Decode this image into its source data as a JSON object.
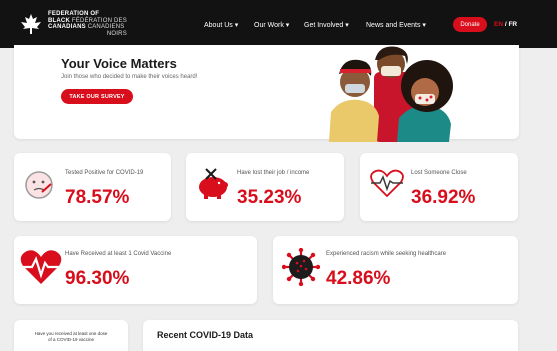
{
  "nav": {
    "logo": {
      "line1": "FEDERATION OF",
      "line2_bold": "BLACK",
      "line2_light": "FÉDÉRATION DES",
      "line3_bold": "CANADIANS",
      "line3_light": "CANADIENS",
      "line4": "NOIRS"
    },
    "items": [
      "About Us ▾",
      "Our Work ▾",
      "Get Involved ▾",
      "News and Events ▾"
    ],
    "donate_label": "Donate",
    "lang_en": "EN",
    "lang_sep": " / ",
    "lang_fr": "FR"
  },
  "hero": {
    "title": "Your Voice Matters",
    "subtitle": "Join those who decided to make their voices heard!",
    "button_label": "TAKE OUR SURVEY"
  },
  "stats": [
    {
      "label": "Tested Positive for COVID-19",
      "value": "78.57%",
      "icon": "sick-face-icon"
    },
    {
      "label": "Have lost their job / income",
      "value": "35.23%",
      "icon": "broken-piggy-bank-icon"
    },
    {
      "label": "Lost Someone Close",
      "value": "36.92%",
      "icon": "heartbeat-icon"
    },
    {
      "label": "Have Received at least 1 Covid Vaccine",
      "value": "96.30%",
      "icon": "heart-pulse-icon"
    },
    {
      "label": "Experienced racism while seeking healthcare",
      "value": "42.86%",
      "icon": "virus-icon"
    }
  ],
  "bottom": {
    "question_line1": "Have you received at least one dose",
    "question_line2": "of a COVID-19 vaccine",
    "recent_title": "Recent COVID-19 Data"
  },
  "colors": {
    "accent": "#d80e1c",
    "nav_bg": "#121212",
    "page_bg": "#eeeeee"
  }
}
